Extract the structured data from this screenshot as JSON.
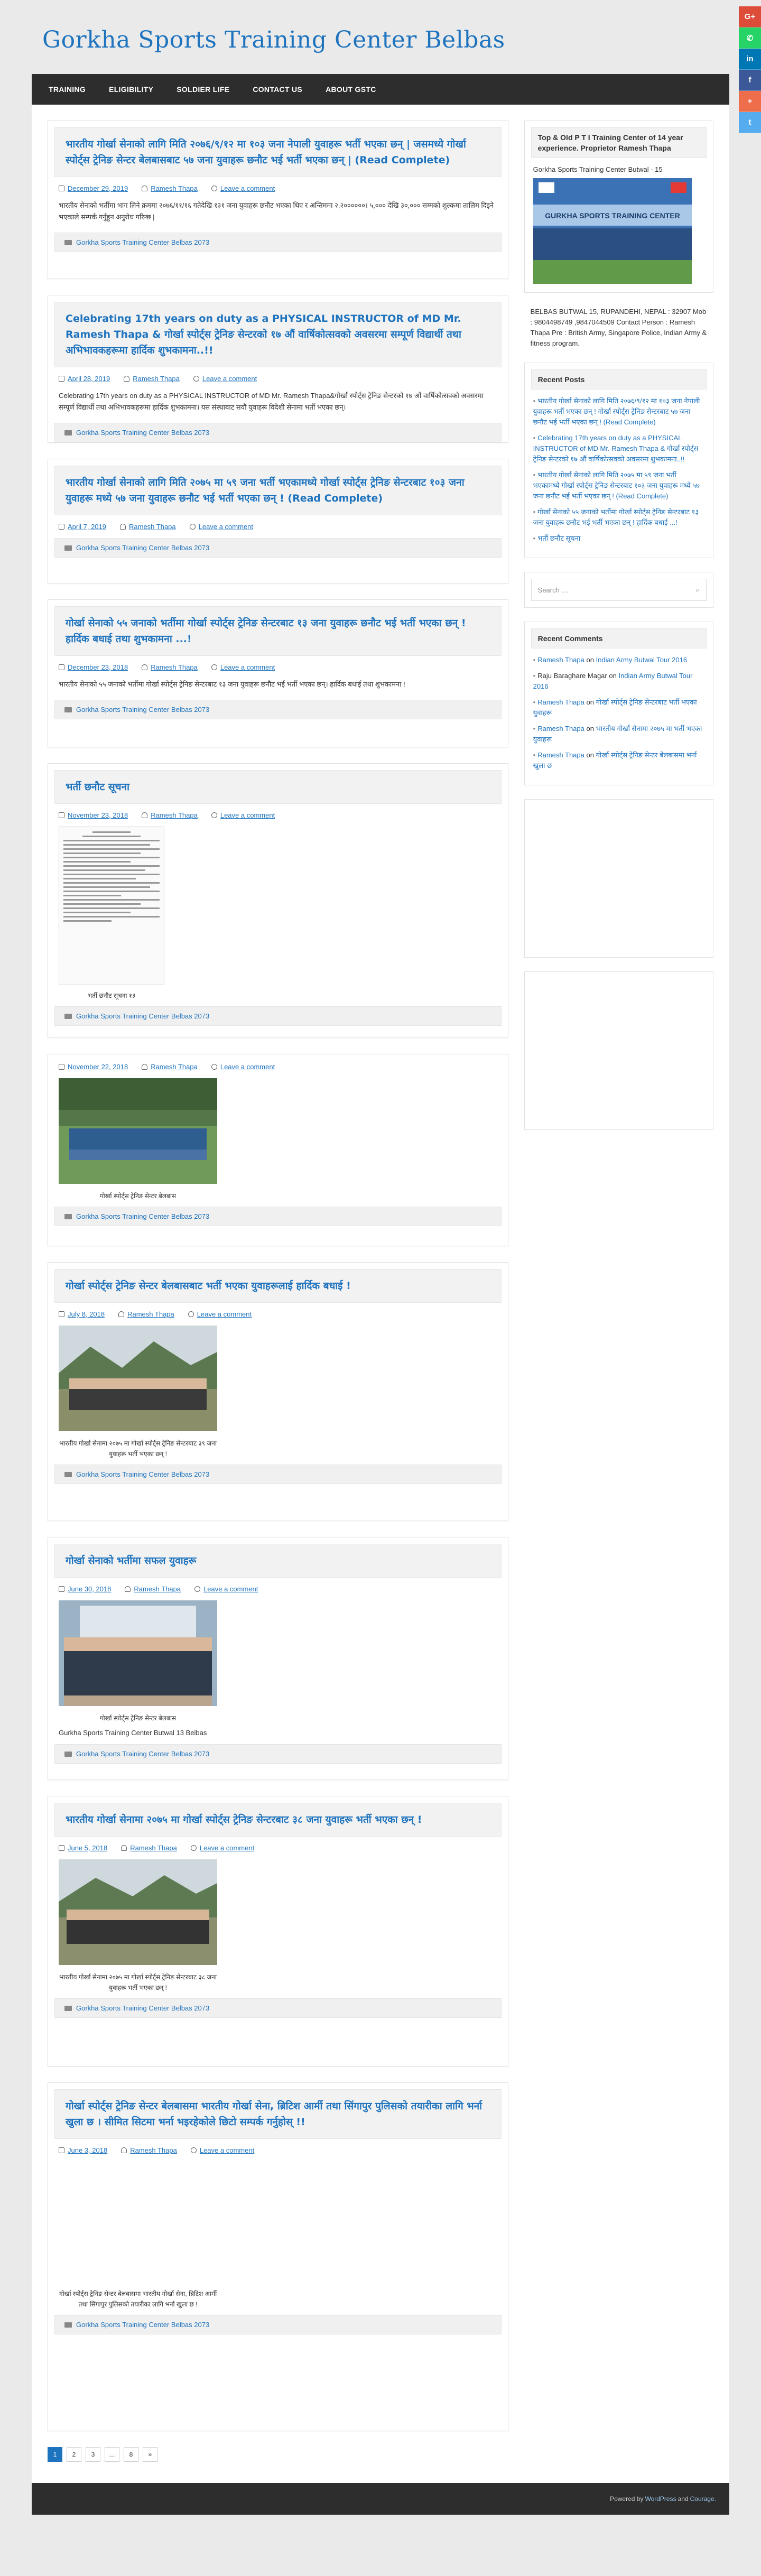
{
  "site": {
    "title": "Gorkha Sports Training Center Belbas"
  },
  "social": [
    {
      "label": "G+",
      "color": "#dd4b39"
    },
    {
      "label": "✆",
      "color": "#25d366"
    },
    {
      "label": "in",
      "color": "#0077b5"
    },
    {
      "label": "f",
      "color": "#3b5998"
    },
    {
      "label": "+",
      "color": "#ee6e4b"
    },
    {
      "label": "t",
      "color": "#55acee"
    }
  ],
  "nav": [
    "TRAINING",
    "ELIGIBILITY",
    "SOLDIER LIFE",
    "CONTACT US",
    "ABOUT GSTC"
  ],
  "meta_labels": {
    "comment": "Leave a comment",
    "author": "Ramesh Thapa"
  },
  "category_label": "Gorkha Sports Training Center Belbas 2073",
  "posts": [
    {
      "title": "भारतीय गोर्खा सेनाको लागि मिति २०७६/९/१२ मा १०३ जना नेपाली युवाहरू भर्ती भएका छन् | जसमध्ये गोर्खा स्पोर्ट्स ट्रेनिङ सेन्टर बेलबासबाट ५७ जना युवाहरू छनौट भई भर्ती भएका छन् | (Read Complete)",
      "date": "December 29, 2019",
      "summary": "भारतीय सेनाको भर्तीमा भाग लिने क्रममा २०७६/११/१६ गतेदेखि १३१ जना युवाहरू छनौट भएका थिए र अन्तिममा २,२००००००। ५,००० देखि ३०,००० सम्मको शुल्कमा तालिम दिइने भएकाले सम्पर्क गर्नुहुन अनुरोध गरिन्छ |"
    },
    {
      "title": "Celebrating 17th years on duty as a PHYSICAL INSTRUCTOR of MD Mr. Ramesh Thapa & गोर्खा स्पोर्ट्स ट्रेनिङ सेन्टरको १७ औं वार्षिकोत्सवको अवसरमा सम्पूर्ण विद्यार्थी तथा अभिभावकहरूमा हार्दिक शुभकामना..!!",
      "date": "April 28, 2019",
      "summary": "Celebrating 17th years on duty as a PHYSICAL INSTRUCTOR of MD Mr. Ramesh Thapa&गोर्खा स्पोर्ट्स ट्रेनिङ सेन्टरको १७ औं वार्षिकोत्सवको अवसरमा सम्पूर्ण विद्यार्थी तथा अभिभावकहरूमा हार्दिक शुभकामना। यस संस्थाबाट सयौं युवाहरू विदेशी सेनामा भर्ती भएका छन्।"
    },
    {
      "title": "भारतीय गोर्खा सेनाको लागि मिति २०७५ मा ५९ जना भर्ती भएकामध्ये गोर्खा स्पोर्ट्स ट्रेनिङ सेन्टरबाट १०३ जना युवाहरू मध्ये ५७ जना युवाहरू छनौट भई भर्ती भएका छन् ! (Read Complete)",
      "date": "April 7, 2019",
      "summary": ""
    },
    {
      "title": "गोर्खा सेनाको ५५ जनाको भर्तीमा गोर्खा स्पोर्ट्स ट्रेनिङ सेन्टरबाट १३ जना युवाहरू छनौट भई भर्ती भएका छन् ! हार्दिक बधाई तथा शुभकामना ...!",
      "date": "December 23, 2018",
      "summary": "भारतीय सेनाको ५५ जनाको भर्तीमा गोर्खा स्पोर्ट्स ट्रेनिङ सेन्टरबाट १३ जना युवाहरू छनौट भई भर्ती भएका छन्। हार्दिक बधाई तथा शुभकामना !"
    },
    {
      "title": "भर्ती छनौट सूचना",
      "date": "November 23, 2018",
      "caption": "भर्ती छनौट सूचना १३"
    },
    {
      "title": "",
      "date": "November 22, 2018",
      "caption": "गोर्खा स्पोर्ट्स ट्रेनिङ सेन्टर बेलबास"
    },
    {
      "title": "गोर्खा स्पोर्ट्स ट्रेनिङ सेन्टर बेलबासबाट भर्ती भएका युवाहरूलाई हार्दिक बधाई !",
      "date": "July 8, 2018",
      "caption": "भारतीय गोर्खा सेनामा २०७५ मा गोर्खा स्पोर्ट्स ट्रेनिङ सेन्टरबाट ३९ जना युवाहरू भर्ती भएका छन् !"
    },
    {
      "title": "गोर्खा सेनाको भर्तीमा सफल युवाहरू",
      "date": "June 30, 2018",
      "caption": "गोर्खा स्पोर्ट्स ट्रेनिङ सेन्टर बेलबास",
      "caption2": "Gurkha Sports Training Center Butwal 13 Belbas"
    },
    {
      "title": "भारतीय गोर्खा सेनामा २०७५ मा गोर्खा स्पोर्ट्स ट्रेनिङ सेन्टरबाट ३८ जना युवाहरू भर्ती भएका छन् !",
      "date": "June 5, 2018",
      "caption": "भारतीय गोर्खा सेनामा २०७५ मा गोर्खा स्पोर्ट्स ट्रेनिङ सेन्टरबाट ३८ जना युवाहरू भर्ती भएका छन् !"
    },
    {
      "title": "गोर्खा स्पोर्ट्स ट्रेनिङ सेन्टर बेलबासमा भारतीय गोर्खा सेना, ब्रिटिश आर्मी तथा सिंगापुर पुलिसको तयारीका लागि भर्ना खुला छ । सीमित सिटमा भर्ना भइरहेकोले छिटो सम्पर्क गर्नुहोस् !!",
      "date": "June 3, 2018",
      "caption": "गोर्खा स्पोर्ट्स ट्रेनिङ सेन्टर बेलबासमा भारतीय गोर्खा सेना, ब्रिटिश आर्मी तथा सिंगापुर पुलिसको तयारीका लागि भर्ना खुला छ !"
    }
  ],
  "pagination": [
    "1",
    "2",
    "3",
    "…",
    "8",
    "»"
  ],
  "sidebar": {
    "top_widget": {
      "title": "Top & Old P T I Training Center of 14 year experience. Proprietor Ramesh Thapa",
      "image_caption": "Gorkha Sports Training Center Butwal - 15",
      "banner_text": "GURKHA SPORTS TRAINING CENTER"
    },
    "contact_text": "BELBAS BUTWAL 15, RUPANDEHI, NEPAL : 32907 Mob : 9804498749 ,9847044509 Contact Person : Ramesh Thapa Pre : British Army, Singapore Police, Indian Army & fitness program.",
    "recent_posts_title": "Recent Posts",
    "recent_posts": [
      "भारतीय गोर्खा सेनाको लागि मिति २०७६/९/१२ मा १०३ जना नेपाली युवाहरू भर्ती भएका छन् ! गोर्खा स्पोर्ट्स ट्रेनिङ सेन्टरबाट ५७ जना छनौट भई भर्ती भएका छन् ! (Read Complete)",
      "Celebrating 17th years on duty as a PHYSICAL INSTRUCTOR of MD Mr. Ramesh Thapa & गोर्खा स्पोर्ट्स ट्रेनिङ सेन्टरको १७ औं वार्षिकोत्सवको अवसरमा शुभकामना..!!",
      "भारतीय गोर्खा सेनाको लागि मिति २०७५ मा ५९ जना भर्ती भएकामध्ये गोर्खा स्पोर्ट्स ट्रेनिङ सेन्टरबाट १०३ जना युवाहरू मध्ये ५७ जना छनौट भई भर्ती भएका छन् ! (Read Complete)",
      "गोर्खा सेनाको ५५ जनाको भर्तीमा गोर्खा स्पोर्ट्स ट्रेनिङ सेन्टरबाट १३ जना युवाहरू छनौट भई भर्ती भएका छन् ! हार्दिक बधाई ...!",
      "भर्ती छनौट सूचना"
    ],
    "search_placeholder": "Search …",
    "recent_comments_title": "Recent Comments",
    "recent_comments": [
      {
        "author": "Ramesh Thapa",
        "on": "on",
        "post": "Indian Army Butwal Tour 2016"
      },
      {
        "author": "Raju Baraghare Magar",
        "on": "on",
        "post": "Indian Army Butwal Tour 2016"
      },
      {
        "author": "Ramesh Thapa",
        "on": "on",
        "post": "गोर्खा स्पोर्ट्स ट्रेनिङ सेन्टरबाट भर्ती भएका युवाहरू"
      },
      {
        "author": "Ramesh Thapa",
        "on": "on",
        "post": "भारतीय गोर्खा सेनामा २०७५ मा भर्ती भएका युवाहरू"
      },
      {
        "author": "Ramesh Thapa",
        "on": "on",
        "post": "गोर्खा स्पोर्ट्स ट्रेनिङ सेन्टर बेलबासमा भर्ना खुला छ"
      }
    ]
  },
  "footer": {
    "powered": "Powered by",
    "wp": "WordPress",
    "and": "and",
    "theme": "Courage."
  }
}
